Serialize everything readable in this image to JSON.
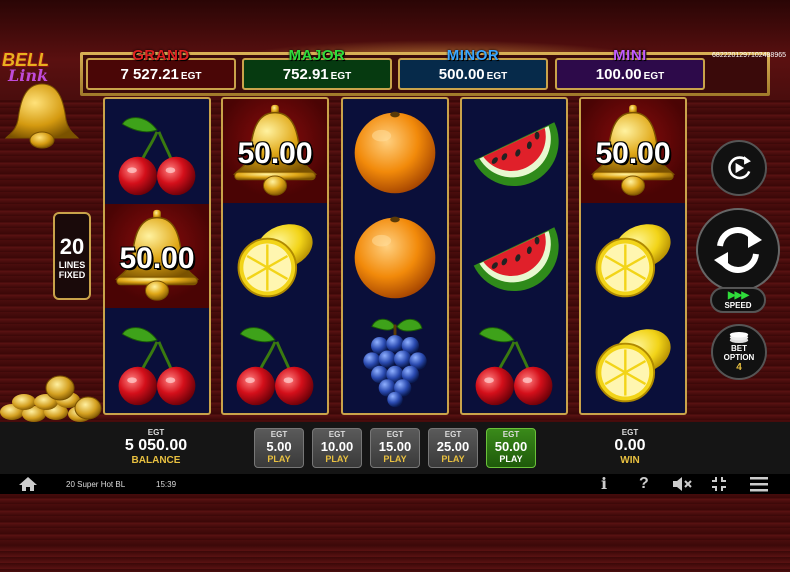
{
  "session_id": "6822201297102488965",
  "logo": {
    "line1": "BELL",
    "line2": "Link"
  },
  "jackpots": [
    {
      "name": "GRAND",
      "value": "7 527.21",
      "currency": "EGT"
    },
    {
      "name": "MAJOR",
      "value": "752.91",
      "currency": "EGT"
    },
    {
      "name": "MINOR",
      "value": "500.00",
      "currency": "EGT"
    },
    {
      "name": "MINI",
      "value": "100.00",
      "currency": "EGT"
    }
  ],
  "lines": {
    "count": "20",
    "label1": "LINES",
    "label2": "FIXED"
  },
  "reels": [
    [
      "cherry",
      "bell",
      "cherry"
    ],
    [
      "bell",
      "lemon",
      "cherry"
    ],
    [
      "orange",
      "orange",
      "grapes"
    ],
    [
      "watermelon",
      "watermelon",
      "cherry"
    ],
    [
      "bell",
      "lemon",
      "lemon"
    ]
  ],
  "bell_values": {
    "r1c1": "50.00",
    "r2c0": "50.00",
    "r5c0": "50.00"
  },
  "controls": {
    "autoplay_icon": "autoplay-icon",
    "spin_icon": "spin-icon",
    "speed_label": "SPEED",
    "bet_option_label1": "BET",
    "bet_option_label2": "OPTION",
    "bet_option_value": "4"
  },
  "balance": {
    "currency": "EGT",
    "value": "5 050.00",
    "label": "BALANCE"
  },
  "bets": [
    {
      "currency": "EGT",
      "value": "5.00",
      "label": "PLAY",
      "active": false
    },
    {
      "currency": "EGT",
      "value": "10.00",
      "label": "PLAY",
      "active": false
    },
    {
      "currency": "EGT",
      "value": "15.00",
      "label": "PLAY",
      "active": false
    },
    {
      "currency": "EGT",
      "value": "25.00",
      "label": "PLAY",
      "active": false
    },
    {
      "currency": "EGT",
      "value": "50.00",
      "label": "PLAY",
      "active": true
    }
  ],
  "win": {
    "currency": "EGT",
    "value": "0.00",
    "label": "WIN"
  },
  "status": {
    "game_name": "20 Super Hot BL",
    "time": "15:39",
    "info_glyph": "i",
    "help_glyph": "?"
  },
  "colors": {
    "grand": "#e02020",
    "major": "#2fdc3a",
    "minor": "#3aa6ff",
    "mini": "#c25cff",
    "accent": "#e8c040"
  }
}
